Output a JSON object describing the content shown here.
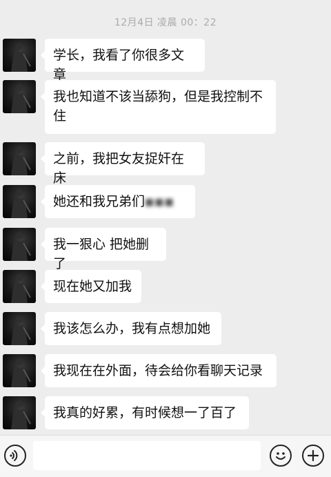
{
  "timestamp": "12月4日 凌晨 00：22",
  "messages": [
    {
      "text": "学长，我看了你很多文章"
    },
    {
      "text": "我也知道不该当舔狗，但是我控制不住"
    },
    {
      "text": "之前，我把女友捉奸在床"
    },
    {
      "text": "她还和我兄弟们",
      "blurred": "■■■"
    },
    {
      "text": "我一狠心 把她删了"
    },
    {
      "text": "现在她又加我"
    },
    {
      "text": "我该怎么办，我有点想加她"
    },
    {
      "text": "我现在在外面，待会给你看聊天记录"
    },
    {
      "text": "我真的好累，有时候想一了百了"
    }
  ],
  "input_bar": {
    "voice_icon": "voice-icon",
    "emoji_icon": "emoji-icon",
    "plus_icon": "plus-icon",
    "input_value": ""
  }
}
